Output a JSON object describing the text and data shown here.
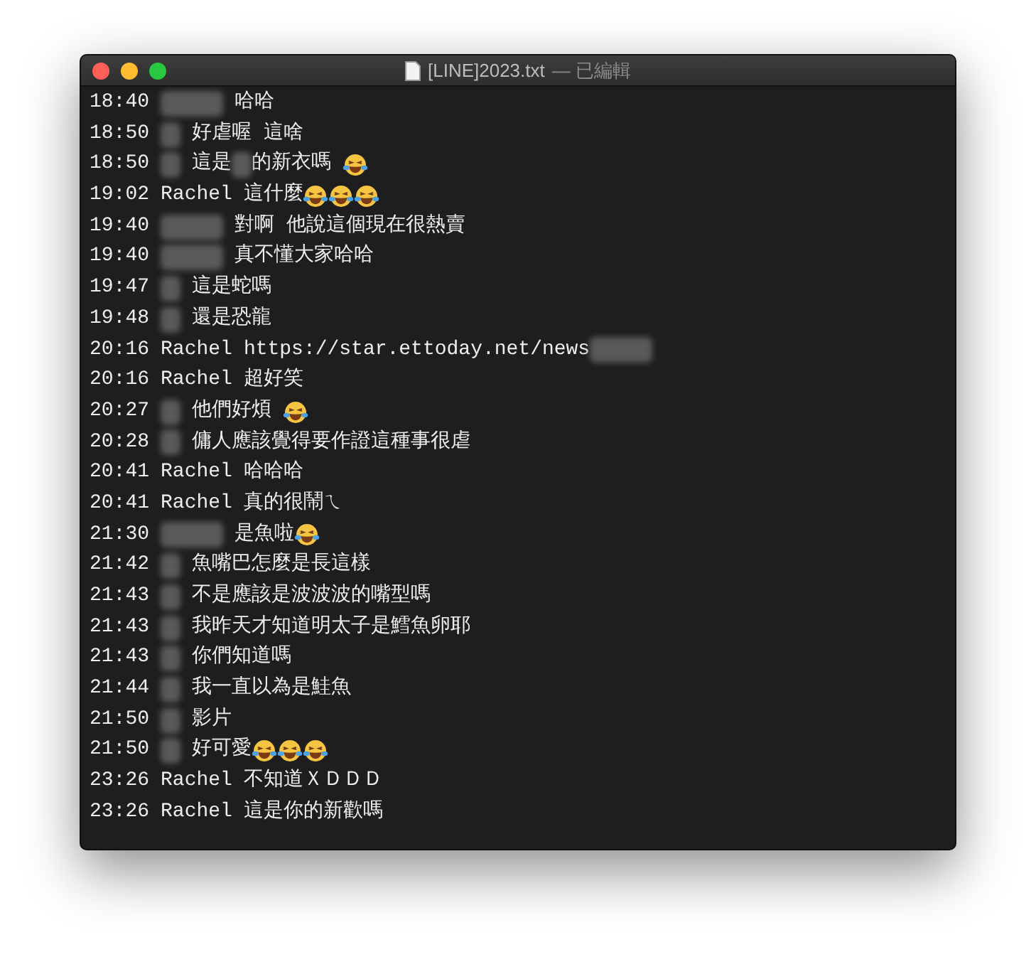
{
  "window": {
    "title": "[LINE]2023.txt",
    "status": "— 已編輯"
  },
  "lines": [
    {
      "time": "18:40",
      "sender": {
        "kind": "hiddenwide"
      },
      "message": [
        {
          "kind": "text",
          "text": "哈哈"
        }
      ]
    },
    {
      "time": "18:50",
      "sender": {
        "kind": "hiddennarrow"
      },
      "message": [
        {
          "kind": "text",
          "text": "好虐喔 這啥"
        }
      ]
    },
    {
      "time": "18:50",
      "sender": {
        "kind": "hiddennarrow"
      },
      "message": [
        {
          "kind": "text",
          "text": "這是"
        },
        {
          "kind": "hiddennarrow"
        },
        {
          "kind": "text",
          "text": "的新衣嗎 "
        },
        {
          "kind": "emoji"
        }
      ]
    },
    {
      "time": "19:02",
      "sender": {
        "kind": "name",
        "text": "Rachel"
      },
      "message": [
        {
          "kind": "text",
          "text": "這什麼"
        },
        {
          "kind": "emoji"
        },
        {
          "kind": "emoji"
        },
        {
          "kind": "emoji"
        }
      ]
    },
    {
      "time": "19:40",
      "sender": {
        "kind": "hiddenwide"
      },
      "message": [
        {
          "kind": "text",
          "text": "對啊 他說這個現在很熱賣"
        }
      ]
    },
    {
      "time": "19:40",
      "sender": {
        "kind": "hiddenwide"
      },
      "message": [
        {
          "kind": "text",
          "text": "真不懂大家哈哈"
        }
      ]
    },
    {
      "time": "19:47",
      "sender": {
        "kind": "hiddennarrow"
      },
      "message": [
        {
          "kind": "text",
          "text": "這是蛇嗎"
        }
      ]
    },
    {
      "time": "19:48",
      "sender": {
        "kind": "hiddennarrow"
      },
      "message": [
        {
          "kind": "text",
          "text": "還是恐龍"
        }
      ]
    },
    {
      "time": "20:16",
      "sender": {
        "kind": "name",
        "text": "Rachel"
      },
      "message": [
        {
          "kind": "text",
          "text": "https://star.ettoday.net/news"
        },
        {
          "kind": "hiddenwide"
        }
      ]
    },
    {
      "time": "20:16",
      "sender": {
        "kind": "name",
        "text": "Rachel"
      },
      "message": [
        {
          "kind": "text",
          "text": "超好笑"
        }
      ]
    },
    {
      "time": "20:27",
      "sender": {
        "kind": "hiddennarrow"
      },
      "message": [
        {
          "kind": "text",
          "text": "他們好煩 "
        },
        {
          "kind": "emoji"
        }
      ]
    },
    {
      "time": "20:28",
      "sender": {
        "kind": "hiddennarrow"
      },
      "message": [
        {
          "kind": "text",
          "text": "傭人應該覺得要作證這種事很虐"
        }
      ]
    },
    {
      "time": "20:41",
      "sender": {
        "kind": "name",
        "text": "Rachel"
      },
      "message": [
        {
          "kind": "text",
          "text": "哈哈哈"
        }
      ]
    },
    {
      "time": "20:41",
      "sender": {
        "kind": "name",
        "text": "Rachel"
      },
      "message": [
        {
          "kind": "text",
          "text": "真的很鬧ㄟ"
        }
      ]
    },
    {
      "time": "21:30",
      "sender": {
        "kind": "hiddenwide"
      },
      "message": [
        {
          "kind": "text",
          "text": "是魚啦"
        },
        {
          "kind": "emoji"
        }
      ]
    },
    {
      "time": "21:42",
      "sender": {
        "kind": "hiddennarrow"
      },
      "message": [
        {
          "kind": "text",
          "text": "魚嘴巴怎麼是長這樣"
        }
      ]
    },
    {
      "time": "21:43",
      "sender": {
        "kind": "hiddennarrow"
      },
      "message": [
        {
          "kind": "text",
          "text": "不是應該是波波波的嘴型嗎"
        }
      ]
    },
    {
      "time": "21:43",
      "sender": {
        "kind": "hiddennarrow"
      },
      "message": [
        {
          "kind": "text",
          "text": "我昨天才知道明太子是鱈魚卵耶"
        }
      ]
    },
    {
      "time": "21:43",
      "sender": {
        "kind": "hiddennarrow"
      },
      "message": [
        {
          "kind": "text",
          "text": "你們知道嗎"
        }
      ]
    },
    {
      "time": "21:44",
      "sender": {
        "kind": "hiddennarrow"
      },
      "message": [
        {
          "kind": "text",
          "text": "我一直以為是鮭魚"
        }
      ]
    },
    {
      "time": "21:50",
      "sender": {
        "kind": "hiddennarrow"
      },
      "message": [
        {
          "kind": "text",
          "text": "影片"
        }
      ]
    },
    {
      "time": "21:50",
      "sender": {
        "kind": "hiddennarrow"
      },
      "message": [
        {
          "kind": "text",
          "text": "好可愛"
        },
        {
          "kind": "emoji"
        },
        {
          "kind": "emoji"
        },
        {
          "kind": "emoji"
        }
      ]
    },
    {
      "time": "23:26",
      "sender": {
        "kind": "name",
        "text": "Rachel"
      },
      "message": [
        {
          "kind": "text",
          "text": "不知道ＸＤＤＤ"
        }
      ]
    },
    {
      "time": "23:26",
      "sender": {
        "kind": "name",
        "text": "Rachel"
      },
      "message": [
        {
          "kind": "text",
          "text": "這是你的新歡嗎"
        }
      ]
    }
  ]
}
